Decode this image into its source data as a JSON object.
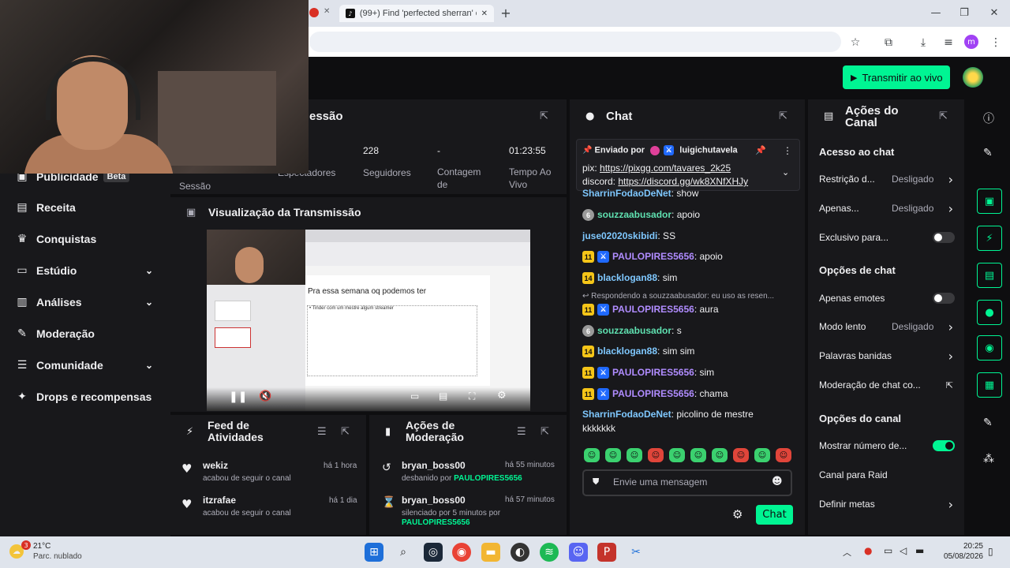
{
  "browser": {
    "tabs": [
      {
        "label": "(99+) Find 'perfected sherran' o"
      }
    ],
    "new_tab": "+"
  },
  "header": {
    "go_live": "Transmitir ao vivo"
  },
  "sidebar": {
    "items": [
      {
        "label": "Publicidade",
        "badge": "Beta"
      },
      {
        "label": "Receita"
      },
      {
        "label": "Conquistas"
      },
      {
        "label": "Estúdio"
      },
      {
        "label": "Análises"
      },
      {
        "label": "Moderação"
      },
      {
        "label": "Comunidade"
      },
      {
        "label": "Drops e recompensas"
      }
    ]
  },
  "session": {
    "title": "essão",
    "label": "Sessão",
    "stats": [
      {
        "value": "",
        "label": "Espectadores"
      },
      {
        "value": "228",
        "label": "Seguidores"
      },
      {
        "value": "-",
        "label": "Contagem de"
      },
      {
        "value": "01:23:55",
        "label": "Tempo Ao Vivo"
      }
    ]
  },
  "preview": {
    "title": "Visualização da Transmissão",
    "slide_title": "Pra essa semana oq podemos ter",
    "slide_bullet": "• Tinder com um mestre algum streamer"
  },
  "activity": {
    "title": "Feed de Atividades",
    "items": [
      {
        "name": "wekiz",
        "action": "acabou de seguir o canal",
        "time": "há 1 hora"
      },
      {
        "name": "itzrafae",
        "action": "acabou de seguir o canal",
        "time": "há 1 dia"
      }
    ]
  },
  "modactions": {
    "title": "Ações de Moderação",
    "items": [
      {
        "name": "bryan_boss00",
        "action": "desbanido por",
        "by": "PAULOPIRES5656",
        "time": "há 55 minutos"
      },
      {
        "name": "bryan_boss00",
        "action": "silenciado por 5 minutos por",
        "by": "PAULOPIRES5656",
        "time": "há 57 minutos"
      }
    ]
  },
  "chat": {
    "title": "Chat",
    "pinned": {
      "pinned_by": "Enviado por",
      "pinner": "luigichutavela",
      "line1_label": "pix:",
      "line1_link": "https://pixgg.com/tavares_2k25",
      "line2_label": "discord:",
      "line2_link": "https://discord.gg/wk8XNfXHJy"
    },
    "messages": [
      {
        "badge": "",
        "user": "SharrinFodaoDeNet",
        "color": "#7fc8ff",
        "text": ": show"
      },
      {
        "badge": "6",
        "user": "souzzaabusador",
        "color": "#5fe0b0",
        "text": ": apoio"
      },
      {
        "badge": "",
        "user": "juse02020skibidi",
        "color": "#7fc8ff",
        "text": ": SS"
      },
      {
        "badge": "11",
        "user": "PAULOPIRES5656",
        "color": "#b08cff",
        "text": ": apoio"
      },
      {
        "badge": "14",
        "user": "blacklogan88",
        "color": "#7fc8ff",
        "text": ": sim"
      },
      {
        "reply": "Respondendo a souzzaabusador: eu uso as resen..."
      },
      {
        "badge": "11",
        "user": "PAULOPIRES5656",
        "color": "#b08cff",
        "text": ": aura"
      },
      {
        "badge": "6",
        "user": "souzzaabusador",
        "color": "#5fe0b0",
        "text": ": s"
      },
      {
        "badge": "14",
        "user": "blacklogan88",
        "color": "#7fc8ff",
        "text": ": sim sim"
      },
      {
        "badge": "11",
        "user": "PAULOPIRES5656",
        "color": "#b08cff",
        "text": ": sim"
      },
      {
        "badge": "11",
        "user": "PAULOPIRES5656",
        "color": "#b08cff",
        "text": ": chama"
      },
      {
        "badge": "",
        "user": "SharrinFodaoDeNet",
        "color": "#7fc8ff",
        "text": ": picolino de mestre kkkkkkk"
      }
    ],
    "placeholder": "Envie uma mensagem",
    "send": "Chat"
  },
  "channel_actions": {
    "title": "Ações do Canal",
    "sections": [
      {
        "heading": "Acesso ao chat",
        "rows": [
          {
            "label": "Restrição d...",
            "value": "Desligado",
            "kind": "chev"
          },
          {
            "label": "Apenas...",
            "value": "Desligado",
            "kind": "chev"
          },
          {
            "label": "Exclusivo para...",
            "value": "",
            "kind": "toggle-off"
          }
        ]
      },
      {
        "heading": "Opções de chat",
        "rows": [
          {
            "label": "Apenas emotes",
            "value": "",
            "kind": "toggle-off"
          },
          {
            "label": "Modo lento",
            "value": "Desligado",
            "kind": "chev"
          },
          {
            "label": "Palavras banidas",
            "value": "",
            "kind": "chev"
          },
          {
            "label": "Moderação de chat co...",
            "value": "",
            "kind": "ext"
          }
        ]
      },
      {
        "heading": "Opções do canal",
        "rows": [
          {
            "label": "Mostrar número de...",
            "value": "",
            "kind": "toggle-on"
          },
          {
            "label": "Canal para Raid",
            "value": "",
            "kind": "none"
          },
          {
            "label": "Definir metas",
            "value": "",
            "kind": "chev"
          }
        ]
      }
    ]
  },
  "taskbar": {
    "weather_temp": "21°C",
    "weather_desc": "Parc. nublado",
    "weather_badge": "3",
    "time": "20:25",
    "date": "05/08/2026"
  },
  "colors": {
    "accent": "#00f593",
    "bg": "#0e0e10",
    "panel": "#18181b"
  }
}
